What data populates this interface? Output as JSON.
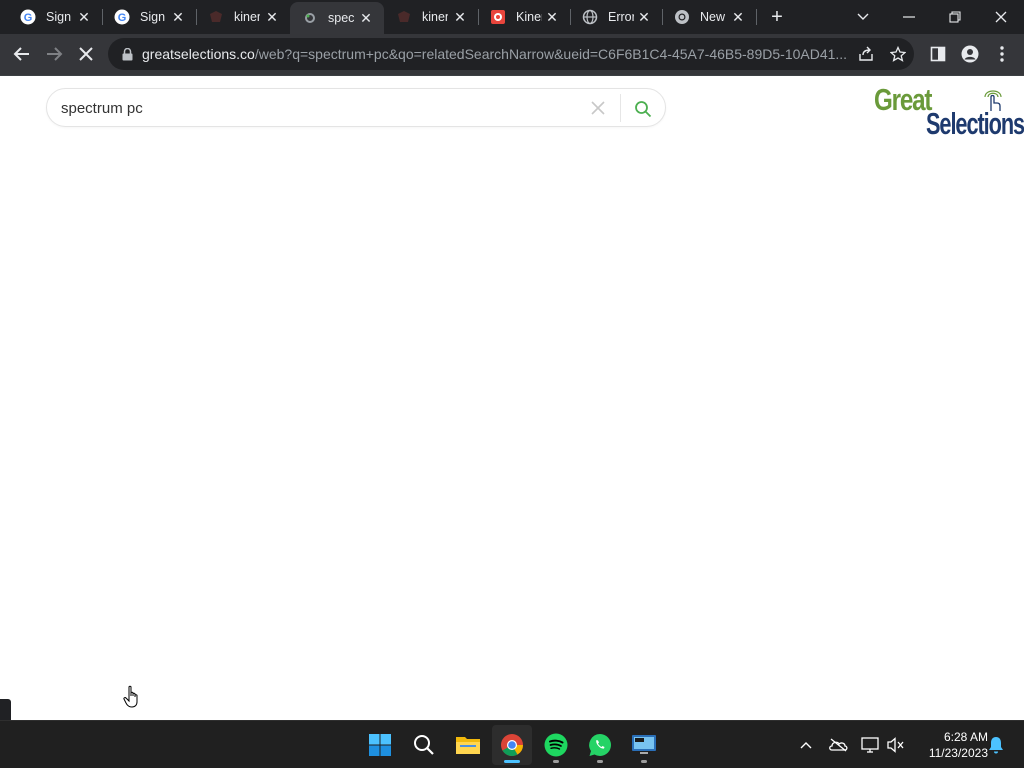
{
  "browser": {
    "tabs": [
      {
        "title": "Sign in – Google",
        "icon": "google-icon",
        "active": false
      },
      {
        "title": "Sign in – Google",
        "icon": "google-icon",
        "active": false
      },
      {
        "title": "kinen",
        "icon": "kinen-icon",
        "active": false
      },
      {
        "title": "spectrum pc",
        "icon": "greatselections-icon",
        "active": true
      },
      {
        "title": "kinen",
        "icon": "kinen-icon",
        "active": false
      },
      {
        "title": "Kinen",
        "icon": "kinen-red-icon",
        "active": false
      },
      {
        "title": "Error",
        "icon": "globe-icon",
        "active": false
      },
      {
        "title": "New Tab",
        "icon": "chrome-icon",
        "active": false
      }
    ],
    "url_host": "greatselections.co",
    "url_path": "/web?q=spectrum+pc&qo=relatedSearchNarrow&ueid=C6F6B1C4-45A7-46B5-89D5-10AD41..."
  },
  "page": {
    "search_value": "spectrum pc",
    "logo_top": "Great",
    "logo_bottom": "Selections"
  },
  "taskbar": {
    "time": "6:28 AM",
    "date": "11/23/2023",
    "apps": [
      "start-button",
      "search-button",
      "file-explorer",
      "chrome",
      "spotify",
      "whatsapp",
      "remote-desktop"
    ]
  },
  "colors": {
    "logo_green": "#6a9a3a",
    "logo_navy": "#1e3a6e",
    "search_icon": "#4caf50"
  }
}
